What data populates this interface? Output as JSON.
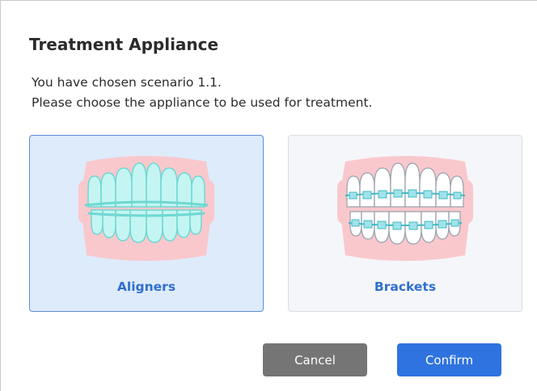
{
  "dialog": {
    "title": "Treatment Appliance",
    "line1": "You have chosen scenario 1.1.",
    "line2": "Please choose the appliance to be used for treatment."
  },
  "options": [
    {
      "label": "Aligners",
      "icon": "aligners-teeth-icon",
      "selected": true
    },
    {
      "label": "Brackets",
      "icon": "brackets-teeth-icon",
      "selected": false
    }
  ],
  "buttons": {
    "cancel": "Cancel",
    "confirm": "Confirm"
  },
  "colors": {
    "accent": "#2f73e0",
    "selected_bg": "#deebfb",
    "gum": "#f9c8cd",
    "aligner": "#bff3f1"
  }
}
